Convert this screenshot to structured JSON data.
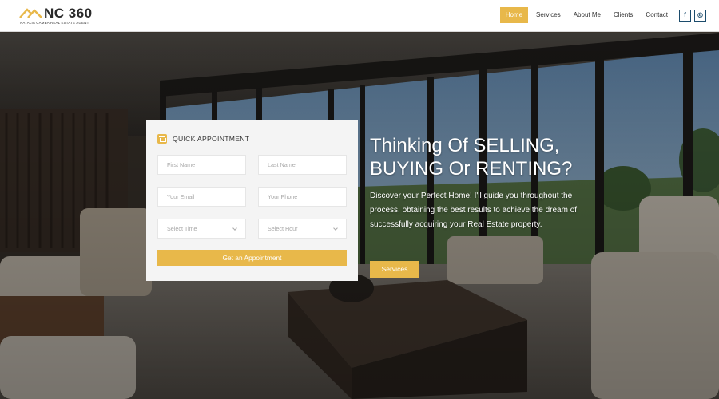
{
  "brand": {
    "name": "NC 360",
    "tagline": "NATALIA CAMBA REAL ESTATE AGENT",
    "accent_color": "#e8b84a"
  },
  "nav": {
    "items": [
      {
        "label": "Home",
        "active": true
      },
      {
        "label": "Services",
        "active": false
      },
      {
        "label": "About Me",
        "active": false
      },
      {
        "label": "Clients",
        "active": false
      },
      {
        "label": "Contact",
        "active": false
      }
    ],
    "social": [
      {
        "glyph": "f",
        "icon": "facebook-icon"
      },
      {
        "glyph": "◎",
        "icon": "instagram-icon"
      }
    ]
  },
  "appointment": {
    "title": "QUICK APPOINTMENT",
    "icon": "calendar-icon",
    "first_name_placeholder": "First Name",
    "last_name_placeholder": "Last Name",
    "email_placeholder": "Your Email",
    "phone_placeholder": "Your Phone",
    "time_select": "Select Time",
    "hour_select": "Select Hour",
    "submit_label": "Get an Appointment"
  },
  "hero": {
    "headline_line1": "Thinking Of SELLING,",
    "headline_line2": "BUYING Or RENTING?",
    "description": "Discover your Perfect Home! I'll guide you throughout the process, obtaining the best results to achieve the dream of successfully acquiring your Real Estate property.",
    "cta_label": "Services"
  }
}
